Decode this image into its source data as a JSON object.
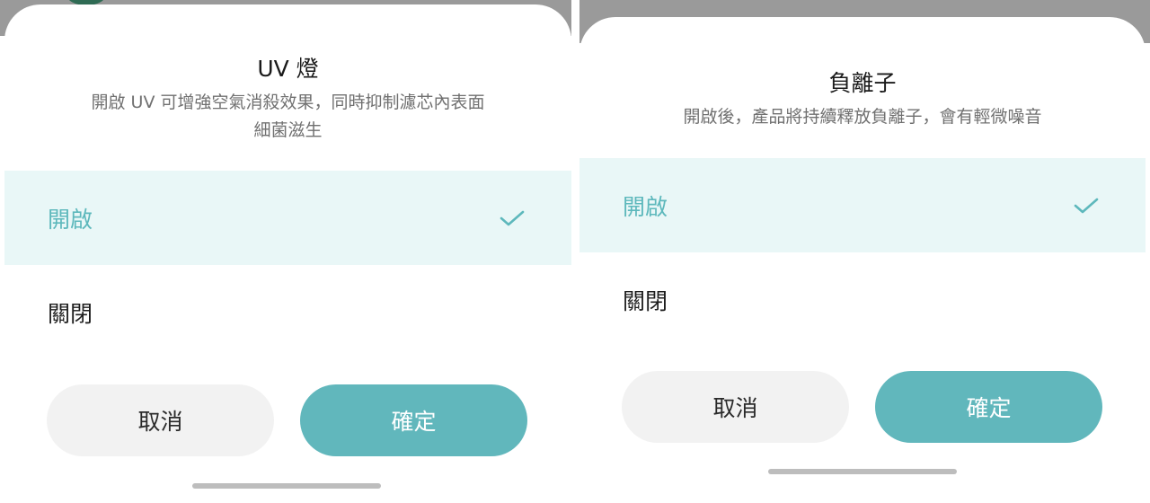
{
  "colors": {
    "accent": "#61b7bc",
    "selected_row_bg": "#e9f7f7",
    "selected_text": "#5db8bc",
    "cancel_bg": "#f2f2f2",
    "backdrop": "#9a9a9a"
  },
  "uv_sheet": {
    "title": "UV 燈",
    "description_line1": "開啟 UV 可增強空氣消殺效果，同時抑制濾芯內表面",
    "description_line2": "細菌滋生",
    "options": [
      {
        "label": "開啟",
        "selected": true
      },
      {
        "label": "關閉",
        "selected": false
      }
    ],
    "cancel_label": "取消",
    "confirm_label": "確定"
  },
  "ion_sheet": {
    "title": "負離子",
    "description": "開啟後，產品將持續釋放負離子，會有輕微噪音",
    "options": [
      {
        "label": "開啟",
        "selected": true
      },
      {
        "label": "關閉",
        "selected": false
      }
    ],
    "cancel_label": "取消",
    "confirm_label": "確定"
  },
  "icons": {
    "selected_marker": "checkmark-icon"
  }
}
